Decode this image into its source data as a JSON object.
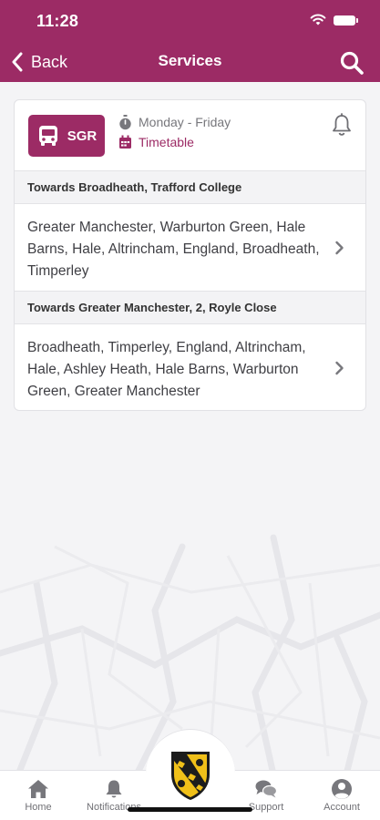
{
  "status_bar": {
    "time": "11:28"
  },
  "header": {
    "back_label": "Back",
    "title": "Services"
  },
  "service": {
    "route": "SGR",
    "days": "Monday - Friday",
    "timetable_label": "Timetable",
    "directions": [
      {
        "heading": "Towards Broadheath, Trafford College",
        "stops": "Greater Manchester, Warburton Green, Hale Barns, Hale, Altrincham, England, Broadheath, Timperley"
      },
      {
        "heading": "Towards Greater Manchester, 2, Royle Close",
        "stops": "Broadheath, Timperley, England, Altrincham, Hale, Ashley Heath, Hale Barns, Warburton Green, Greater Manchester"
      }
    ]
  },
  "tab_bar": {
    "home": "Home",
    "notifications": "Notifications",
    "support": "Support",
    "account": "Account"
  },
  "colors": {
    "brand": "#9c2b65",
    "background": "#f4f4f6"
  },
  "icons": [
    "chevron-left-icon",
    "search-icon",
    "bus-icon",
    "stopwatch-icon",
    "calendar-icon",
    "bell-icon",
    "chevron-right-icon",
    "home-icon",
    "notifications-bell-icon",
    "chat-icon",
    "account-icon",
    "school-crest-icon"
  ]
}
